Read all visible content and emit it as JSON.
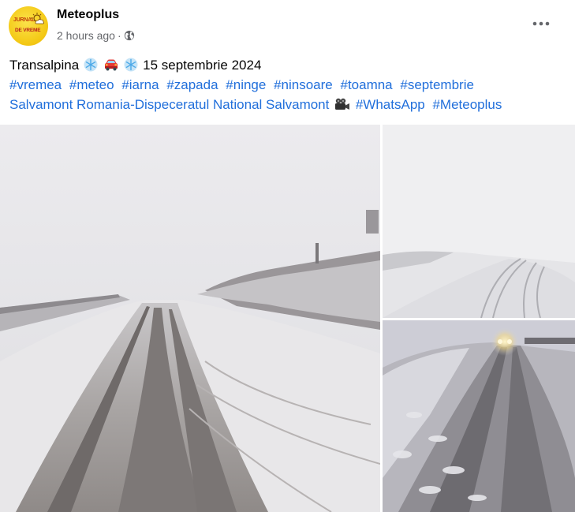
{
  "post": {
    "page_name": "Meteoplus",
    "avatar_text": [
      "JURNAL",
      "DE VREME"
    ],
    "time_ago": "2 hours ago",
    "separator": "·",
    "privacy_icon": "globe-icon",
    "more_icon": "more-options-icon",
    "caption": {
      "line1": {
        "text_start": "Transalpina",
        "emojis": [
          "snowflake-emoji",
          "car-emoji",
          "snowflake-emoji"
        ],
        "text_end": "15 septembrie 2024"
      },
      "hashtags": [
        "#vremea",
        "#meteo",
        "#iarna",
        "#zapada",
        "#ninge",
        "#ninsoare",
        "#toamna",
        "#septembrie"
      ],
      "mention": "Salvamont Romania-Dispeceratul National Salvamont",
      "mention_emoji": "video-camera-emoji",
      "hashtags_end": [
        "#WhatsApp",
        "#Meteoplus"
      ]
    },
    "photos": [
      {
        "label": "snowy-mountain-road-fog"
      },
      {
        "label": "snow-covered-road-whiteout"
      },
      {
        "label": "car-headlights-in-snowstorm"
      }
    ],
    "colors": {
      "link": "#216fdb",
      "meta": "#65676b"
    }
  }
}
